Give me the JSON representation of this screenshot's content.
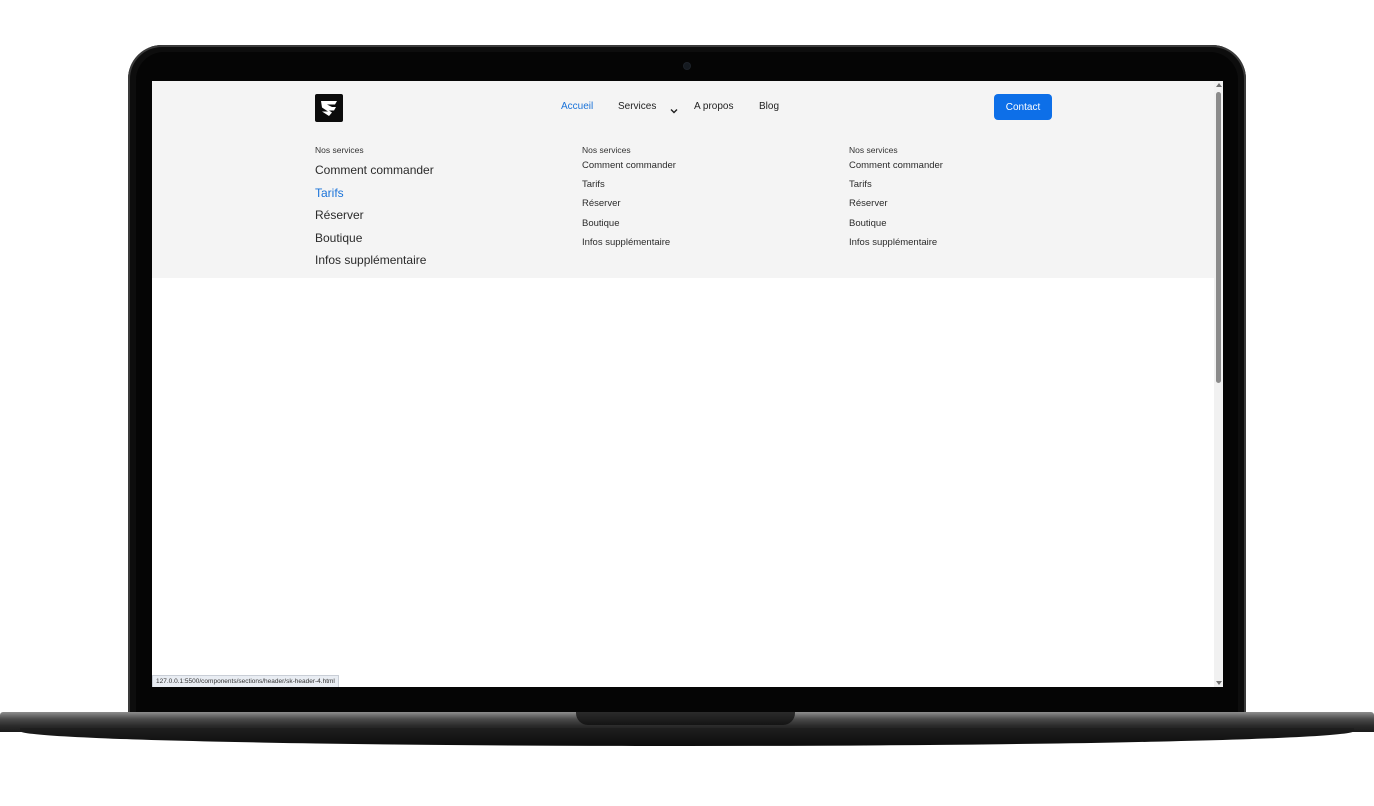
{
  "header": {
    "nav": [
      {
        "label": "Accueil",
        "active": true
      },
      {
        "label": "Services",
        "active": false,
        "has_dropdown": true
      },
      {
        "label": "A propos",
        "active": false
      },
      {
        "label": "Blog",
        "active": false
      }
    ],
    "contact_label": "Contact",
    "accent_color": "#1a73d9",
    "button_color": "#0d6fe8"
  },
  "mega_menu": {
    "columns": [
      {
        "title": "Nos services",
        "items": [
          "Comment commander",
          "Tarifs",
          "Réserver",
          "Boutique",
          "Infos supplémentaire"
        ],
        "active_item": "Tarifs"
      },
      {
        "title": "Nos services",
        "items": [
          "Comment commander",
          "Tarifs",
          "Réserver",
          "Boutique",
          "Infos supplémentaire"
        ]
      },
      {
        "title": "Nos services",
        "items": [
          "Comment commander",
          "Tarifs",
          "Réserver",
          "Boutique",
          "Infos supplémentaire"
        ]
      }
    ]
  },
  "status_bar": {
    "url": "127.0.0.1:5500/components/sections/header/sk-header-4.html"
  },
  "icons": {
    "logo": "brand-logo-icon",
    "dropdown": "chevron-down-icon"
  }
}
